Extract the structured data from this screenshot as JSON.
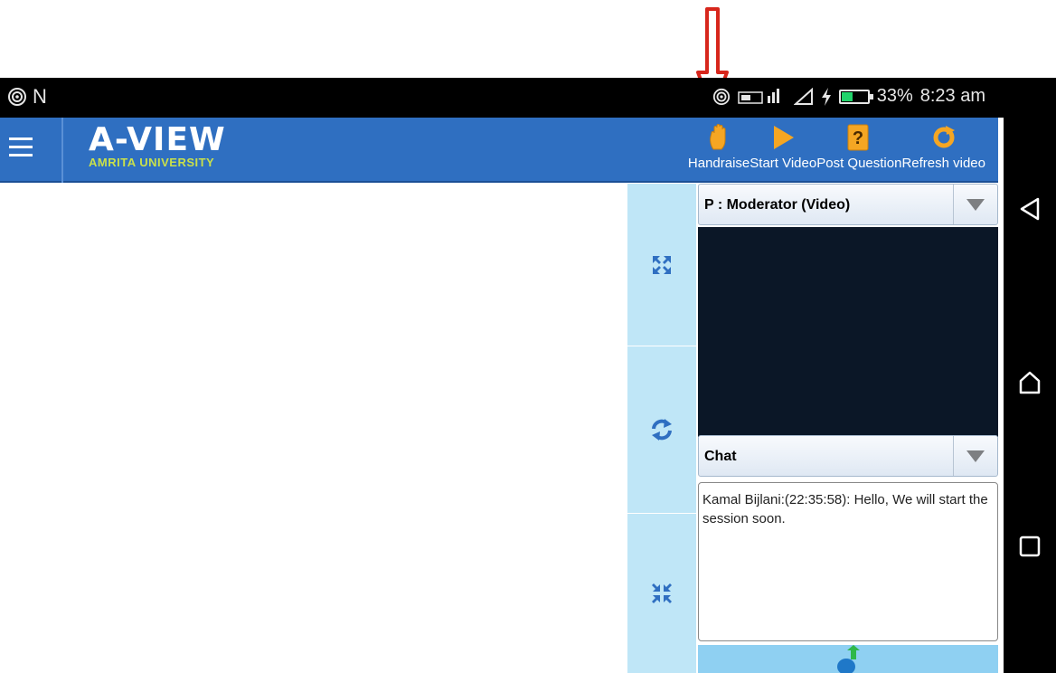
{
  "status_bar": {
    "left_icons": [
      "hotspot-icon"
    ],
    "left_text": "N",
    "right_icons": [
      "hotspot-icon",
      "lte-signal-icon",
      "wifi-icon",
      "charging-icon",
      "battery-icon"
    ],
    "battery_percent": "33%",
    "time": "8:23 am"
  },
  "app_header": {
    "title": "A-VIEW",
    "subtitle": "AMRITA UNIVERSITY",
    "toolbar": [
      {
        "name": "handraise",
        "label": "Handraise",
        "icon": "hand-icon"
      },
      {
        "name": "start-video",
        "label": "Start Video",
        "icon": "play-icon"
      },
      {
        "name": "post-question",
        "label": "Post Question",
        "icon": "question-icon"
      },
      {
        "name": "refresh-video",
        "label": "Refresh video",
        "icon": "refresh-icon"
      }
    ]
  },
  "control_strip": {
    "buttons": [
      {
        "name": "expand",
        "icon": "expand-arrows-icon"
      },
      {
        "name": "swap",
        "icon": "swap-arrows-icon"
      },
      {
        "name": "collapse",
        "icon": "collapse-arrows-icon"
      }
    ]
  },
  "video_panel": {
    "selected": "P : Moderator (Video)"
  },
  "chat_panel": {
    "selected": "Chat",
    "messages": [
      "Kamal Bijlani:(22:35:58): Hello, We will start the session soon."
    ],
    "send_icon": "send-message-icon"
  },
  "nav_bar": {
    "buttons": [
      "back-icon",
      "home-icon",
      "recents-icon"
    ]
  },
  "colors": {
    "app_bar": "#2f6fc1",
    "control_strip": "#bfe6f7",
    "video_bg": "#0b1727",
    "accent_orange": "#f5a623",
    "annotation_red": "#d7261c"
  }
}
